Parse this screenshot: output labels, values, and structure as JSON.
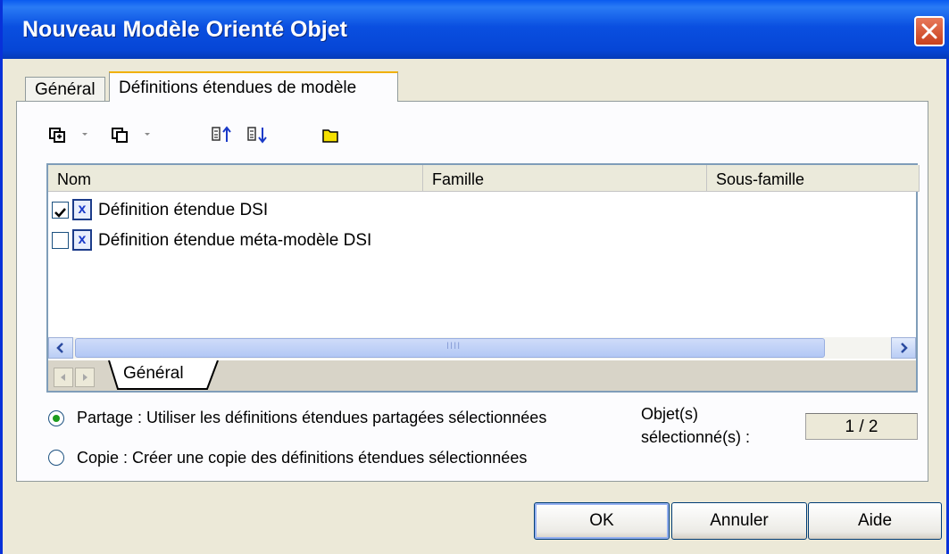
{
  "window": {
    "title": "Nouveau Modèle Orienté Objet"
  },
  "tabs": [
    {
      "label": "Général"
    },
    {
      "label": "Définitions étendues de modèle"
    }
  ],
  "toolbar": {
    "icons": [
      "add-definition-icon",
      "copy-definition-icon",
      "move-up-icon",
      "move-down-icon",
      "folder-icon"
    ]
  },
  "list": {
    "columns": [
      {
        "label": "Nom"
      },
      {
        "label": "Famille"
      },
      {
        "label": "Sous-famille"
      }
    ],
    "rows": [
      {
        "checked": true,
        "name": "Définition étendue DSI"
      },
      {
        "checked": false,
        "name": "Définition étendue méta-modèle DSI"
      }
    ],
    "scroll_grip": "IIII",
    "sheet_tab": "Général"
  },
  "options": {
    "share": {
      "label": "Partage : Utiliser les définitions étendues partagées sélectionnées",
      "selected": true
    },
    "copy": {
      "label": "Copie : Créer une copie des définitions étendues sélectionnées",
      "selected": false
    }
  },
  "selection": {
    "label_line1": "Objet(s)",
    "label_line2": "sélectionné(s) :",
    "count": "1 / 2"
  },
  "buttons": {
    "ok": "OK",
    "cancel": "Annuler",
    "help": "Aide"
  }
}
